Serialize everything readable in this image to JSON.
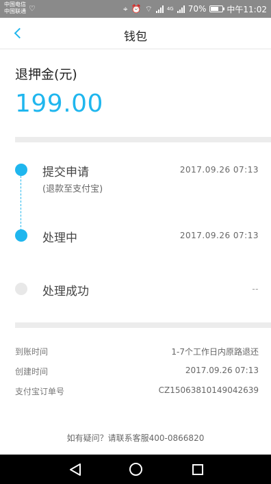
{
  "status_bar": {
    "carrier_1": "中国电信",
    "carrier_2": "中国联通",
    "network_label": "4G",
    "battery": "70%",
    "time": "中午11:02",
    "battery_level": 0.7
  },
  "nav": {
    "title": "钱包",
    "back_icon": "chevron-left-icon"
  },
  "deposit": {
    "label": "退押金(元)",
    "amount": "199.00"
  },
  "timeline": [
    {
      "title": "提交申请",
      "subtitle": "(退款至支付宝)",
      "time": "2017.09.26 07:13",
      "status": "done"
    },
    {
      "title": "处理中",
      "time": "2017.09.26 07:13",
      "status": "done"
    },
    {
      "title": "处理成功",
      "time": "--",
      "status": "pending"
    }
  ],
  "details": [
    {
      "label": "到账时间",
      "value": "1-7个工作日内原路退还"
    },
    {
      "label": "创建时间",
      "value": "2017.09.26 07:13"
    },
    {
      "label": "支付宝订单号",
      "value": "CZ15063810149042639"
    }
  ],
  "footer": {
    "help_text": "如有疑问？请联系客服400-0866820"
  },
  "colors": {
    "accent": "#1fb6ee",
    "divider": "#ececec",
    "status_bar": "#8a8a8a",
    "system_nav": "#000000"
  }
}
